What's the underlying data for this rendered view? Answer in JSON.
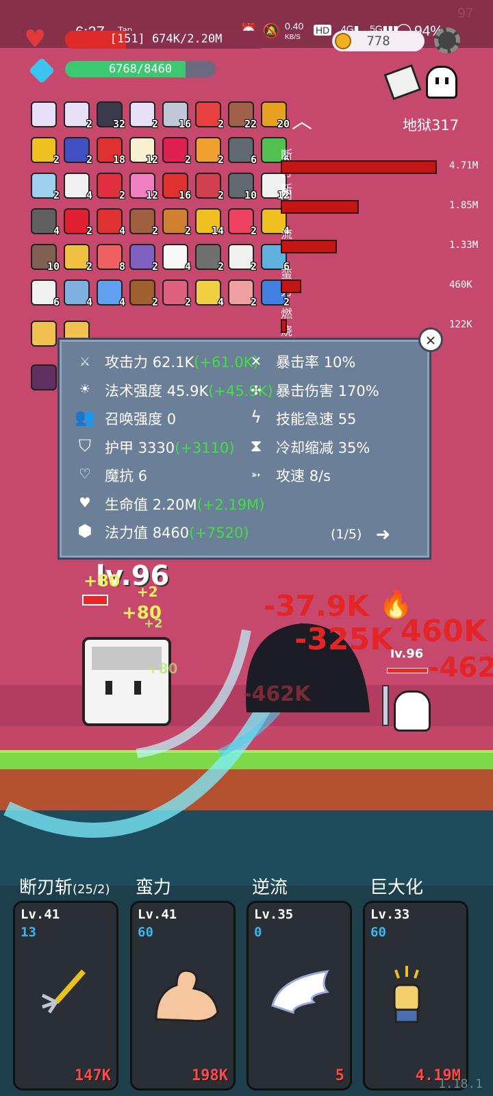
{
  "status_bar": {
    "time": "6:27",
    "tap": "Tap",
    "speed": "0.40",
    "speed_unit": "KB/S",
    "battery": "94%",
    "corner_num": "97"
  },
  "hud": {
    "level_hp": "[151] 674K/2.20M",
    "hp_fill": 0.3,
    "mana": "6768/8460",
    "mana_fill": 0.8,
    "coins": "778",
    "stage": "地狱317"
  },
  "inventory": [
    {
      "c": "",
      "color": "#e8e0f8"
    },
    {
      "c": "2",
      "color": "#e8e0f8"
    },
    {
      "c": "32",
      "color": "#3a3a4a"
    },
    {
      "c": "2",
      "color": "#e8e0f8"
    },
    {
      "c": "16",
      "color": "#c0c8d8"
    },
    {
      "c": "2",
      "color": "#e84040"
    },
    {
      "c": "22",
      "color": "#a0604a"
    },
    {
      "c": "20",
      "color": "#e8a020"
    },
    {
      "c": "2",
      "color": "#f0c020"
    },
    {
      "c": "2",
      "color": "#4050c0"
    },
    {
      "c": "18",
      "color": "#e03030"
    },
    {
      "c": "12",
      "color": "#f8f0d0"
    },
    {
      "c": "2",
      "color": "#e02050"
    },
    {
      "c": "2",
      "color": "#f0a030"
    },
    {
      "c": "6",
      "color": "#606870"
    },
    {
      "c": "6",
      "color": "#50c050"
    },
    {
      "c": "2",
      "color": "#a0d0f0"
    },
    {
      "c": "4",
      "color": "#f0f0f0"
    },
    {
      "c": "2",
      "color": "#e03040"
    },
    {
      "c": "12",
      "color": "#f080c0"
    },
    {
      "c": "16",
      "color": "#e03030"
    },
    {
      "c": "2",
      "color": "#d04050"
    },
    {
      "c": "10",
      "color": "#606870"
    },
    {
      "c": "12",
      "color": "#f0f0f0"
    },
    {
      "c": "4",
      "color": "#606060"
    },
    {
      "c": "2",
      "color": "#e02030"
    },
    {
      "c": "4",
      "color": "#e03030"
    },
    {
      "c": "2",
      "color": "#a06040"
    },
    {
      "c": "2",
      "color": "#d08030"
    },
    {
      "c": "14",
      "color": "#f0c020"
    },
    {
      "c": "2",
      "color": "#f04060"
    },
    {
      "c": "4",
      "color": "#f0c020"
    },
    {
      "c": "10",
      "color": "#806050"
    },
    {
      "c": "2",
      "color": "#f0c040"
    },
    {
      "c": "8",
      "color": "#f06060"
    },
    {
      "c": "2",
      "color": "#8060c0"
    },
    {
      "c": "4",
      "color": "#f8f8f8"
    },
    {
      "c": "2",
      "color": "#707070"
    },
    {
      "c": "2",
      "color": "#f0f0f0"
    },
    {
      "c": "6",
      "color": "#60b0e0"
    },
    {
      "c": "6",
      "color": "#f0f0f0"
    },
    {
      "c": "4",
      "color": "#80b0e0"
    },
    {
      "c": "4",
      "color": "#60a0f0"
    },
    {
      "c": "2",
      "color": "#a06030"
    },
    {
      "c": "2",
      "color": "#e06080"
    },
    {
      "c": "4",
      "color": "#f0d040"
    },
    {
      "c": "2",
      "color": "#f0a0a0"
    },
    {
      "c": "2",
      "color": "#4080e0"
    },
    {
      "c": "",
      "color": "#f0c050"
    },
    {
      "c": "",
      "color": "#f0c050"
    },
    {
      "c": "",
      "color": "#603060"
    }
  ],
  "damage_list": [
    {
      "name": "断刃斩",
      "value": "4.71M",
      "frac": 1.0
    },
    {
      "name": "肉",
      "value": "1.85M",
      "frac": 0.5
    },
    {
      "name": "流",
      "value": "1.33M",
      "frac": 0.36
    },
    {
      "name": "蛮力",
      "value": "460K",
      "frac": 0.13
    },
    {
      "name": "燃烧",
      "value": "122K",
      "frac": 0.04
    }
  ],
  "stats": {
    "left": [
      {
        "icon": "attack-icon",
        "label": "攻击力",
        "value": "62.1K",
        "bonus": "(+61.0K)"
      },
      {
        "icon": "spell-power-icon",
        "label": "法术强度",
        "value": "45.9K",
        "bonus": "(+45.9K)"
      },
      {
        "icon": "summon-icon",
        "label": "召唤强度",
        "value": "0",
        "bonus": ""
      },
      {
        "icon": "armor-icon",
        "label": "护甲",
        "value": "3330",
        "bonus": "(+3110)"
      },
      {
        "icon": "magic-resist-icon",
        "label": "魔抗",
        "value": "6",
        "bonus": ""
      },
      {
        "icon": "heart-icon",
        "label": "生命值",
        "value": "2.20M",
        "bonus": "(+2.19M)"
      },
      {
        "icon": "mana-icon",
        "label": "法力值",
        "value": "8460",
        "bonus": "(+7520)"
      }
    ],
    "right": [
      {
        "icon": "crit-rate-icon",
        "label": "暴击率",
        "value": "10%"
      },
      {
        "icon": "crit-damage-icon",
        "label": "暴击伤害",
        "value": "170%"
      },
      {
        "icon": "skill-haste-icon",
        "label": "技能急速",
        "value": "55"
      },
      {
        "icon": "cooldown-icon",
        "label": "冷却缩减",
        "value": "35%"
      },
      {
        "icon": "attack-speed-icon",
        "label": "攻速",
        "value": "8/s"
      }
    ],
    "page": "(1/5)"
  },
  "scene": {
    "player_level": "lv.96",
    "enemy_level": "lv.96",
    "floats": [
      "+80",
      "+80",
      "+2",
      "+2",
      "+80",
      "-37.9K",
      "-325K",
      "460K",
      "-462",
      "-462K"
    ]
  },
  "skills": [
    {
      "name": "断刃斩",
      "extra": "(25/2)",
      "lv": "Lv.41",
      "cd": "13",
      "dmg": "147K",
      "icon": "trident-icon"
    },
    {
      "name": "蛮力",
      "extra": "",
      "lv": "Lv.41",
      "cd": "60",
      "dmg": "198K",
      "icon": "muscle-icon"
    },
    {
      "name": "逆流",
      "extra": "",
      "lv": "Lv.35",
      "cd": "0",
      "dmg": "5",
      "icon": "wing-icon"
    },
    {
      "name": "巨大化",
      "extra": "",
      "lv": "Lv.33",
      "cd": "60",
      "dmg": "4.19M",
      "icon": "fist-icon"
    }
  ],
  "version": "1.18.1"
}
